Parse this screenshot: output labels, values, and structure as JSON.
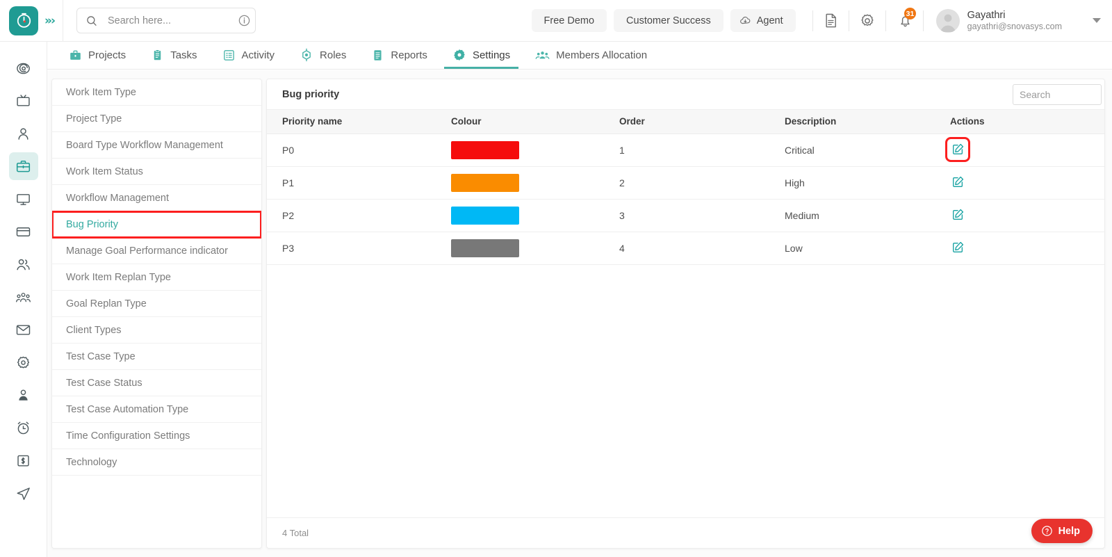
{
  "brand": {
    "logo_icon": "stopwatch-icon",
    "logo_bg": "#1f9b93",
    "accent": "#2aa79b",
    "sidebar_toggle": "»›"
  },
  "header": {
    "search": {
      "placeholder": "Search here...",
      "value": ""
    },
    "search_icon": "search-icon",
    "info_icon": "info-circle-icon",
    "buttons": [
      {
        "label": "Free Demo",
        "icon": null
      },
      {
        "label": "Customer Success",
        "icon": null
      },
      {
        "label": "Agent",
        "icon": "cloud-download-icon"
      }
    ],
    "doc_icon": "document-icon",
    "gear_icon": "gear-icon",
    "bell_icon": "bell-icon",
    "notification_count": "31",
    "notification_badge_color": "#f07612",
    "user": {
      "avatar_icon": "avatar-icon",
      "name": "Gayathri",
      "email": "gayathri@snovasys.com",
      "caret_icon": "chevron-down-icon"
    }
  },
  "nav": {
    "tabs": [
      {
        "label": "Projects",
        "icon": "briefcase-icon",
        "active": false
      },
      {
        "label": "Tasks",
        "icon": "clipboard-icon",
        "active": false
      },
      {
        "label": "Activity",
        "icon": "list-grid-icon",
        "active": false
      },
      {
        "label": "Roles",
        "icon": "target-icon",
        "active": false
      },
      {
        "label": "Reports",
        "icon": "report-icon",
        "active": false
      },
      {
        "label": "Settings",
        "icon": "gear-icon",
        "active": true
      },
      {
        "label": "Members Allocation",
        "icon": "group-icon",
        "active": false
      }
    ]
  },
  "rail": {
    "items": [
      {
        "icon": "eye-spiral-icon",
        "active": false
      },
      {
        "icon": "tv-board-icon",
        "active": false
      },
      {
        "icon": "user-icon",
        "active": false
      },
      {
        "icon": "briefcase-icon",
        "active": true
      },
      {
        "icon": "monitor-icon",
        "active": false
      },
      {
        "icon": "card-icon",
        "active": false
      },
      {
        "icon": "users-icon",
        "active": false
      },
      {
        "icon": "team-icon",
        "active": false
      },
      {
        "icon": "mail-icon",
        "active": false
      },
      {
        "icon": "gear-icon",
        "active": false
      },
      {
        "icon": "user-badge-icon",
        "active": false
      },
      {
        "icon": "alarm-clock-icon",
        "active": false
      },
      {
        "icon": "invoice-icon",
        "active": false
      },
      {
        "icon": "send-icon",
        "active": false
      }
    ]
  },
  "submenu": {
    "items": [
      {
        "label": "Work Item Type",
        "active": false,
        "highlighted": false
      },
      {
        "label": "Project Type",
        "active": false,
        "highlighted": false
      },
      {
        "label": "Board Type Workflow Management",
        "active": false,
        "highlighted": false
      },
      {
        "label": "Work Item Status",
        "active": false,
        "highlighted": false
      },
      {
        "label": "Workflow Management",
        "active": false,
        "highlighted": false
      },
      {
        "label": "Bug Priority",
        "active": true,
        "highlighted": true
      },
      {
        "label": "Manage Goal Performance indicator",
        "active": false,
        "highlighted": false
      },
      {
        "label": "Work Item Replan Type",
        "active": false,
        "highlighted": false
      },
      {
        "label": "Goal Replan Type",
        "active": false,
        "highlighted": false
      },
      {
        "label": "Client Types",
        "active": false,
        "highlighted": false
      },
      {
        "label": "Test Case Type",
        "active": false,
        "highlighted": false
      },
      {
        "label": "Test Case Status",
        "active": false,
        "highlighted": false
      },
      {
        "label": "Test Case Automation Type",
        "active": false,
        "highlighted": false
      },
      {
        "label": "Time Configuration Settings",
        "active": false,
        "highlighted": false
      },
      {
        "label": "Technology",
        "active": false,
        "highlighted": false
      }
    ]
  },
  "panel": {
    "title": "Bug priority",
    "search": {
      "placeholder": "Search",
      "value": ""
    },
    "columns": [
      "Priority name",
      "Colour",
      "Order",
      "Description",
      "Actions"
    ],
    "rows": [
      {
        "priority_name": "P0",
        "colour": "#f50d0d",
        "order": "1",
        "description": "Critical",
        "action_icon": "edit-icon",
        "action_highlighted": true
      },
      {
        "priority_name": "P1",
        "colour": "#fa8c00",
        "order": "2",
        "description": "High",
        "action_icon": "edit-icon",
        "action_highlighted": false
      },
      {
        "priority_name": "P2",
        "colour": "#00b8f5",
        "order": "3",
        "description": "Medium",
        "action_icon": "edit-icon",
        "action_highlighted": false
      },
      {
        "priority_name": "P3",
        "colour": "#787878",
        "order": "4",
        "description": "Low",
        "action_icon": "edit-icon",
        "action_highlighted": false
      }
    ],
    "footer_total": "4 Total"
  },
  "help": {
    "label": "Help",
    "icon": "question-circle-icon",
    "color": "#e8332e"
  },
  "annotations": {
    "box_color": "#fc1f1f"
  }
}
